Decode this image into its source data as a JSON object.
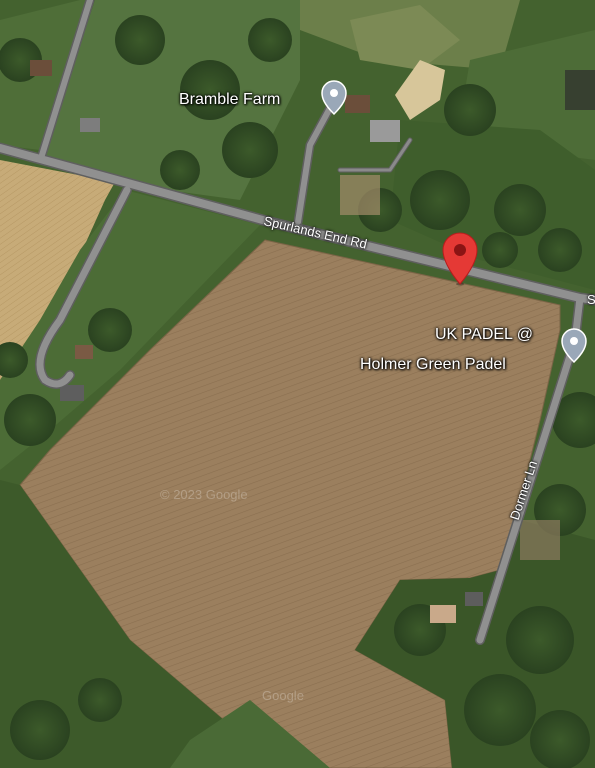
{
  "places": {
    "bramble_farm": "Bramble Farm",
    "padel_line1": "UK PADEL @",
    "padel_line2": "Holmer Green Padel"
  },
  "roads": {
    "spurlands": "Spurlands End Rd",
    "dormer": "Dormer Ln",
    "edge_fragment": "S"
  },
  "watermarks": {
    "copyright": "© 2023 Google",
    "google": "Google"
  },
  "colors": {
    "road": "#8f8f8f",
    "road_outline": "#5f5f5f",
    "field": "#9a7f5f",
    "grass": "#4a6a36",
    "place_pin": "#9aa8b8",
    "location_pin": "#e53935"
  },
  "icons": {
    "place_pin": "place-pin-icon",
    "location_pin": "location-pin-icon"
  }
}
